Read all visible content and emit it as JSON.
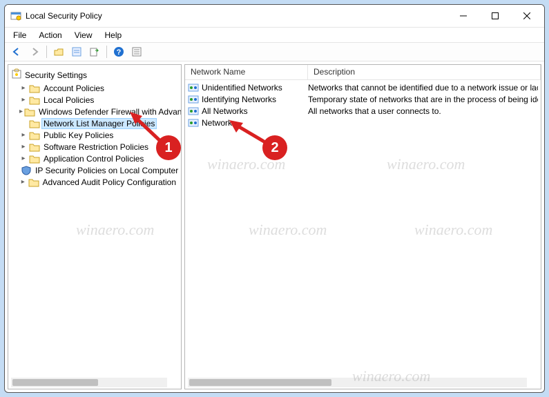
{
  "window": {
    "title": "Local Security Policy"
  },
  "menu": {
    "file": "File",
    "action": "Action",
    "view": "View",
    "help": "Help"
  },
  "tree": {
    "root": "Security Settings",
    "items": [
      {
        "label": "Account Policies",
        "expandable": true
      },
      {
        "label": "Local Policies",
        "expandable": true
      },
      {
        "label": "Windows Defender Firewall with Advanced Security",
        "expandable": true
      },
      {
        "label": "Network List Manager Policies",
        "expandable": false,
        "selected": true
      },
      {
        "label": "Public Key Policies",
        "expandable": true
      },
      {
        "label": "Software Restriction Policies",
        "expandable": true
      },
      {
        "label": "Application Control Policies",
        "expandable": true
      },
      {
        "label": "IP Security Policies on Local Computer",
        "expandable": false,
        "icon": "shield"
      },
      {
        "label": "Advanced Audit Policy Configuration",
        "expandable": true
      }
    ]
  },
  "list": {
    "columns": {
      "name": "Network Name",
      "desc": "Description"
    },
    "rows": [
      {
        "name": "Unidentified Networks",
        "desc": "Networks that cannot be identified due to a network issue or lack of"
      },
      {
        "name": "Identifying Networks",
        "desc": "Temporary state of networks that are in the process of being identified"
      },
      {
        "name": "All Networks",
        "desc": "All networks that a user connects to."
      },
      {
        "name": "Network",
        "desc": ""
      }
    ]
  },
  "annotations": {
    "one": "1",
    "two": "2"
  },
  "watermark": "winaero.com"
}
